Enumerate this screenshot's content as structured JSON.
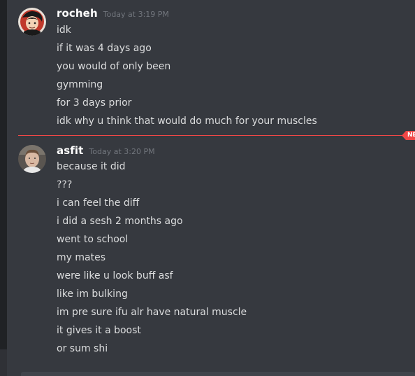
{
  "colors": {
    "background": "#36393f",
    "sidebar": "#202225",
    "username": "#ffffff",
    "timestamp": "#72767d",
    "message_text": "#dcddde",
    "new_divider": "#f04747"
  },
  "groups": [
    {
      "username": "rocheh",
      "timestamp": "Today at 3:19 PM",
      "avatar_icon": "anime-avatar",
      "lines": [
        "idk",
        "if it was 4 days ago",
        "you would of only been",
        "gymming",
        "for 3 days prior",
        "idk why u think that would do much for your muscles"
      ]
    },
    {
      "username": "asfit",
      "timestamp": "Today at 3:20 PM",
      "avatar_icon": "photo-avatar",
      "lines": [
        "because it did",
        "???",
        "i can feel the diff",
        "i did a sesh 2 months ago",
        "went to school",
        "my mates",
        "were like u look buff asf",
        "like im bulking",
        "im pre sure ifu alr have natural muscle",
        "it gives it a boost",
        "or sum shi"
      ]
    }
  ],
  "divider": {
    "label": "NEW"
  }
}
